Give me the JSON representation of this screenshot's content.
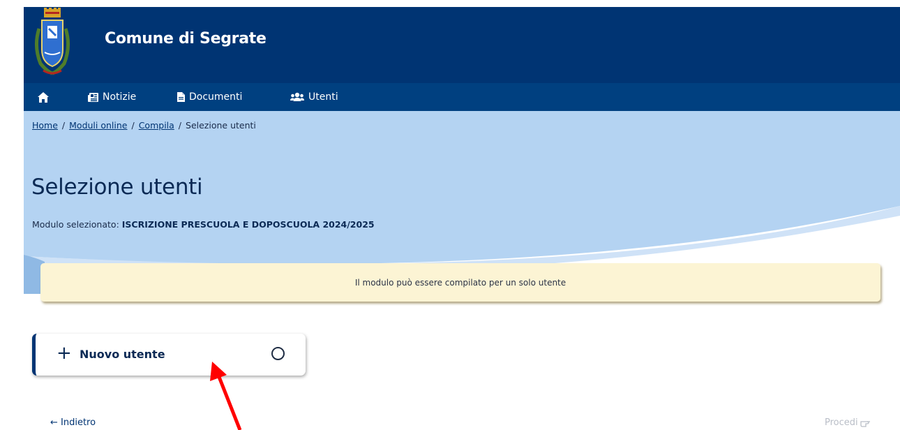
{
  "header": {
    "site_title": "Comune di Segrate",
    "logo_icon": "coat-of-arms-icon",
    "background": "#003473"
  },
  "nav": {
    "background": "#004080",
    "items": [
      {
        "label": "",
        "icon": "home-icon"
      },
      {
        "label": "Notizie",
        "icon": "newspaper-icon"
      },
      {
        "label": "Documenti",
        "icon": "document-icon"
      },
      {
        "label": "Utenti",
        "icon": "users-icon"
      }
    ]
  },
  "breadcrumb": {
    "items": [
      "Home",
      "Moduli online",
      "Compila"
    ],
    "current": "Selezione utenti",
    "separator": "/"
  },
  "page": {
    "title": "Selezione utenti",
    "module_prefix": "Modulo selezionato:",
    "module_name": "ISCRIZIONE PRESCUOLA E DOPOSCUOLA 2024/2025"
  },
  "alert": {
    "text": "Il modulo può essere compilato per un solo utente",
    "background": "#fcf4d4"
  },
  "user_option": {
    "icon": "plus-icon",
    "label": "Nuovo utente",
    "selected": false
  },
  "footer_nav": {
    "back_label": "← Indietro",
    "proceed_label": "Procedi",
    "proceed_icon": "pointing-hand-icon"
  },
  "annotation": {
    "icon": "red-arrow-icon",
    "color": "#ff0000"
  }
}
